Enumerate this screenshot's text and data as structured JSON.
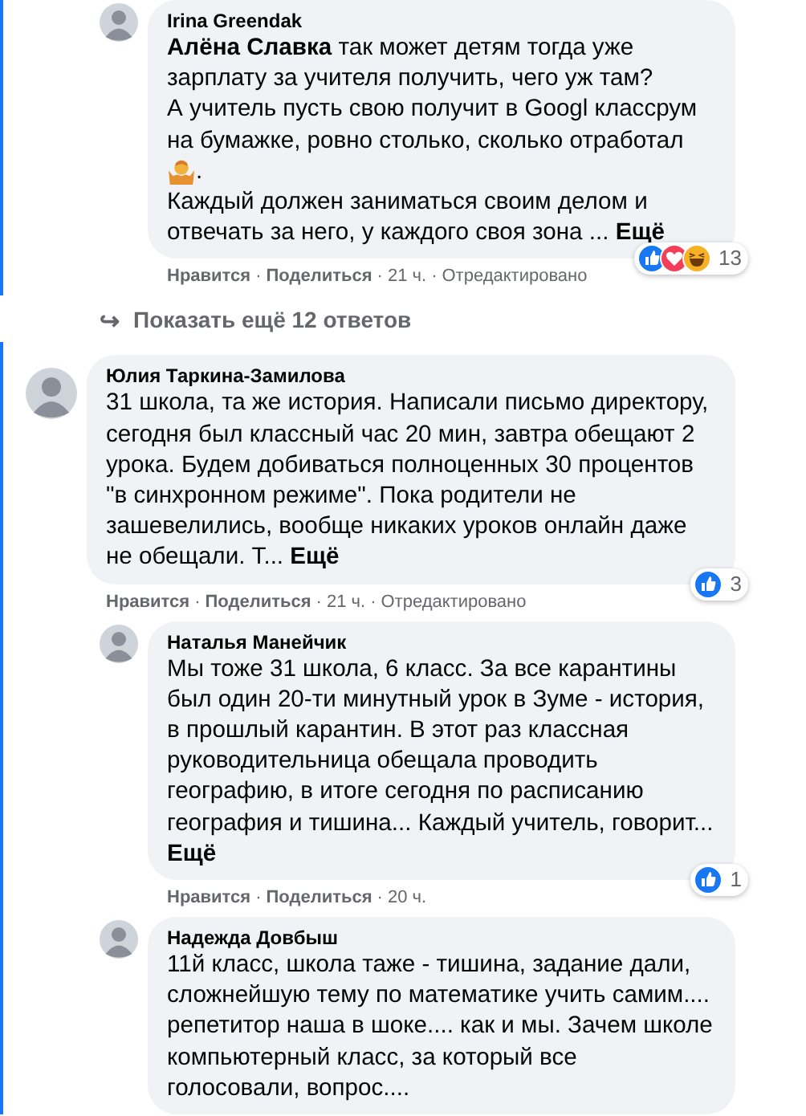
{
  "thread": [
    {
      "kind": "reply",
      "author": "Irina Greendak",
      "paragraphs": [
        {
          "kind": "text",
          "text": "**Алёна Славка** так может детям тогда уже зарплату за учителя получить, чего уж там?"
        },
        {
          "kind": "text",
          "text": "А учитель пусть свою получит в Googl классрум на бумажке, ровно столько, сколько отработал"
        },
        {
          "kind": "emoji",
          "text": "."
        },
        {
          "kind": "text",
          "text": "Каждый должен заниматься своим делом и отвечать за него, у каждого своя зона ..."
        }
      ],
      "more": "Ещё",
      "reactions": [
        {
          "kind": "like"
        },
        {
          "kind": "love"
        },
        {
          "kind": "haha"
        }
      ],
      "reaction_count": "13",
      "actions": [
        "Нравится",
        "Поделиться"
      ],
      "separators": [
        "·",
        "·",
        "·"
      ],
      "time": "21 ч.",
      "edited": "Отредактировано"
    },
    {
      "kind": "more_link",
      "arrow": "↪",
      "text": "Показать ещё 12 ответов"
    },
    {
      "kind": "comment",
      "author": "Юлия Таркина-Замилова",
      "paragraphs": [
        {
          "kind": "text",
          "text": "31 школа, та же история. Написали письмо директору, сегодня был классный час 20 мин, завтра обещают 2 урока. Будем добиваться полноценных 30 процентов \"в синхронном режиме\". Пока родители не зашевелились, вообще никаких уроков онлайн даже не обещали. Т..."
        }
      ],
      "more": "Ещё",
      "reactions": [
        {
          "kind": "like"
        }
      ],
      "reaction_count": "3",
      "actions": [
        "Нравится",
        "Поделиться"
      ],
      "separators": [
        "·",
        "·",
        "·"
      ],
      "time": "21 ч.",
      "edited": "Отредактировано"
    },
    {
      "kind": "reply",
      "author": "Наталья Манейчик",
      "paragraphs": [
        {
          "kind": "text",
          "text": "Мы тоже 31 школа, 6 класс. За все карантины был один 20-ти минутный урок в Зуме - история, в прошлый карантин. В этот раз классная руководительница обещала проводить географию, в итоге сегодня по расписанию география и тишина... Каждый учитель, говорит..."
        }
      ],
      "more": "Ещё",
      "more_on_new_line": true,
      "reactions": [
        {
          "kind": "like"
        }
      ],
      "reaction_count": "1",
      "actions": [
        "Нравится",
        "Поделиться"
      ],
      "separators": [
        "·",
        "·"
      ],
      "time": "20 ч."
    },
    {
      "kind": "reply",
      "author": "Надежда Довбыш",
      "paragraphs": [
        {
          "kind": "text",
          "text": "11й класс, школа таже - тишина, задание дали, сложнейшую тему по математике учить самим.... репетитор наша в шоке.... как и мы. Зачем школе компьютерный класс, за который все голосовали, вопрос...."
        }
      ]
    }
  ]
}
